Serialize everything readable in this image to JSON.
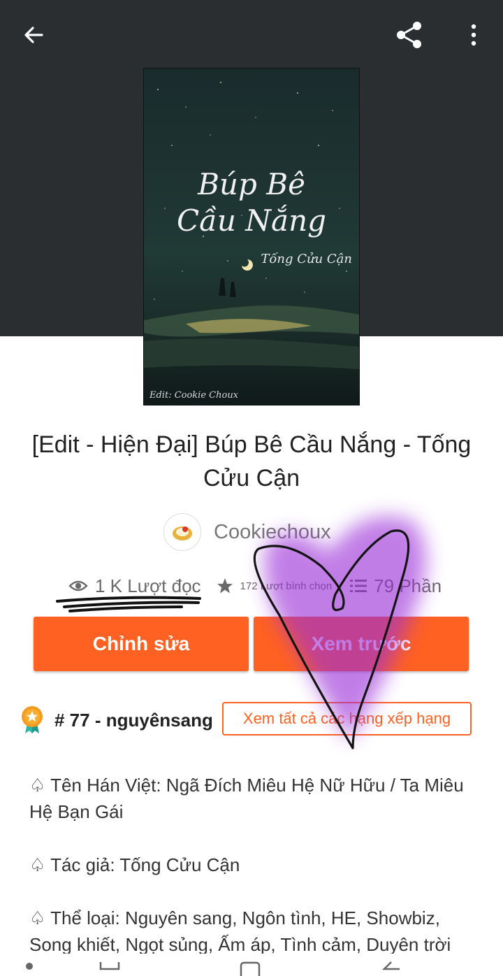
{
  "cover": {
    "title_line1": "Búp Bê",
    "title_line2": "Cầu Nắng",
    "author": "Tống Cửu Cận",
    "credit": "Edit: Cookie Choux"
  },
  "story": {
    "title": "[Edit - Hiện Đại] Búp Bê Cầu Nắng - Tống Cửu Cận",
    "author": "Cookiechoux"
  },
  "stats": {
    "reads": "1 K Lượt đọc",
    "votes": "172 Lượt bình chọn",
    "parts": "79 Phần"
  },
  "actions": {
    "edit": "Chỉnh sửa",
    "preview": "Xem trước"
  },
  "ranking": {
    "text": "# 77 - nguyênsang",
    "link": "Xem tất cả các hạng xếp hạng"
  },
  "description": [
    "♤ Tên Hán Việt: Ngã Đích Miêu Hệ Nữ Hữu / Ta Miêu Hệ Bạn Gái",
    "♤ Tác giả: Tống Cửu Cận",
    "♤ Thể loại: Nguyên sang, Ngôn tình, HE, Showbiz, Song khiết, Ngọt sủng, Ấm áp, Tình cảm, Duyên trời"
  ],
  "colors": {
    "accent": "#ff6122",
    "hero_bg": "#2b2e30"
  },
  "icons": [
    "back-arrow-icon",
    "share-icon",
    "more-vert-icon",
    "eye-icon",
    "star-icon",
    "list-icon",
    "rank-medal-icon"
  ]
}
